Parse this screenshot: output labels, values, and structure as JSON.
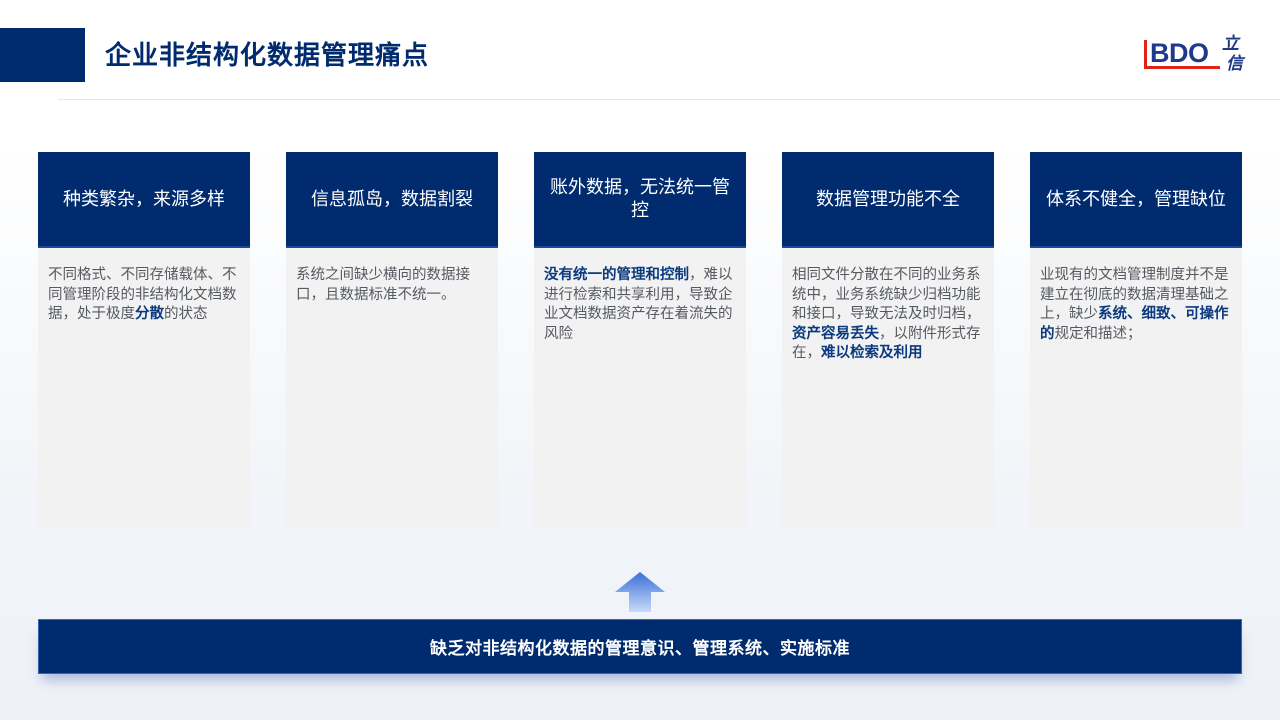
{
  "header": {
    "title": "企业非结构化数据管理痛点",
    "logo": {
      "text": "BDO",
      "cn_top": "立",
      "cn_bottom": "信",
      "brand_color": "#1f3a8a",
      "accent_color": "#e2231a"
    }
  },
  "cards": [
    {
      "title": "种类繁杂，来源多样",
      "body": [
        {
          "text": "不同格式、不同存储载体、不同管理阶段的非结构化文档数据，处于极度",
          "bold": false
        },
        {
          "text": "分散",
          "bold": true
        },
        {
          "text": "的状态",
          "bold": false
        }
      ]
    },
    {
      "title": "信息孤岛，数据割裂",
      "body": [
        {
          "text": "系统之间缺少横向的数据接口，且数据标准不统一。",
          "bold": false
        }
      ]
    },
    {
      "title": "账外数据，无法统一管控",
      "body": [
        {
          "text": "没有统一的管理和控制",
          "bold": true
        },
        {
          "text": "，难以进行检索和共享利用，导致企业文档数据资产存在着流失的风险",
          "bold": false
        }
      ]
    },
    {
      "title": "数据管理功能不全",
      "body": [
        {
          "text": "相同文件分散在不同的业务系统中，业务系统缺少归档功能和接口，导致无法及时归档，",
          "bold": false
        },
        {
          "text": "资产容易丢失",
          "bold": true
        },
        {
          "text": "，以附件形式存在，",
          "bold": false
        },
        {
          "text": "难以检索及利用",
          "bold": true
        }
      ]
    },
    {
      "title": "体系不健全，管理缺位",
      "body": [
        {
          "text": "业现有的文档管理制度并不是建立在彻底的数据清理基础之上，缺少",
          "bold": false
        },
        {
          "text": "系统、细致、可操作的",
          "bold": true
        },
        {
          "text": "规定和描述；",
          "bold": false
        }
      ]
    }
  ],
  "arrow_icon": "up-arrow-icon",
  "conclusion": "缺乏对非结构化数据的管理意识、管理系统、实施标准",
  "colors": {
    "primary": "#002b6e",
    "card_bg": "#f2f2f3",
    "body_text": "#555a60",
    "emphasis_text": "#0b3a7e"
  }
}
